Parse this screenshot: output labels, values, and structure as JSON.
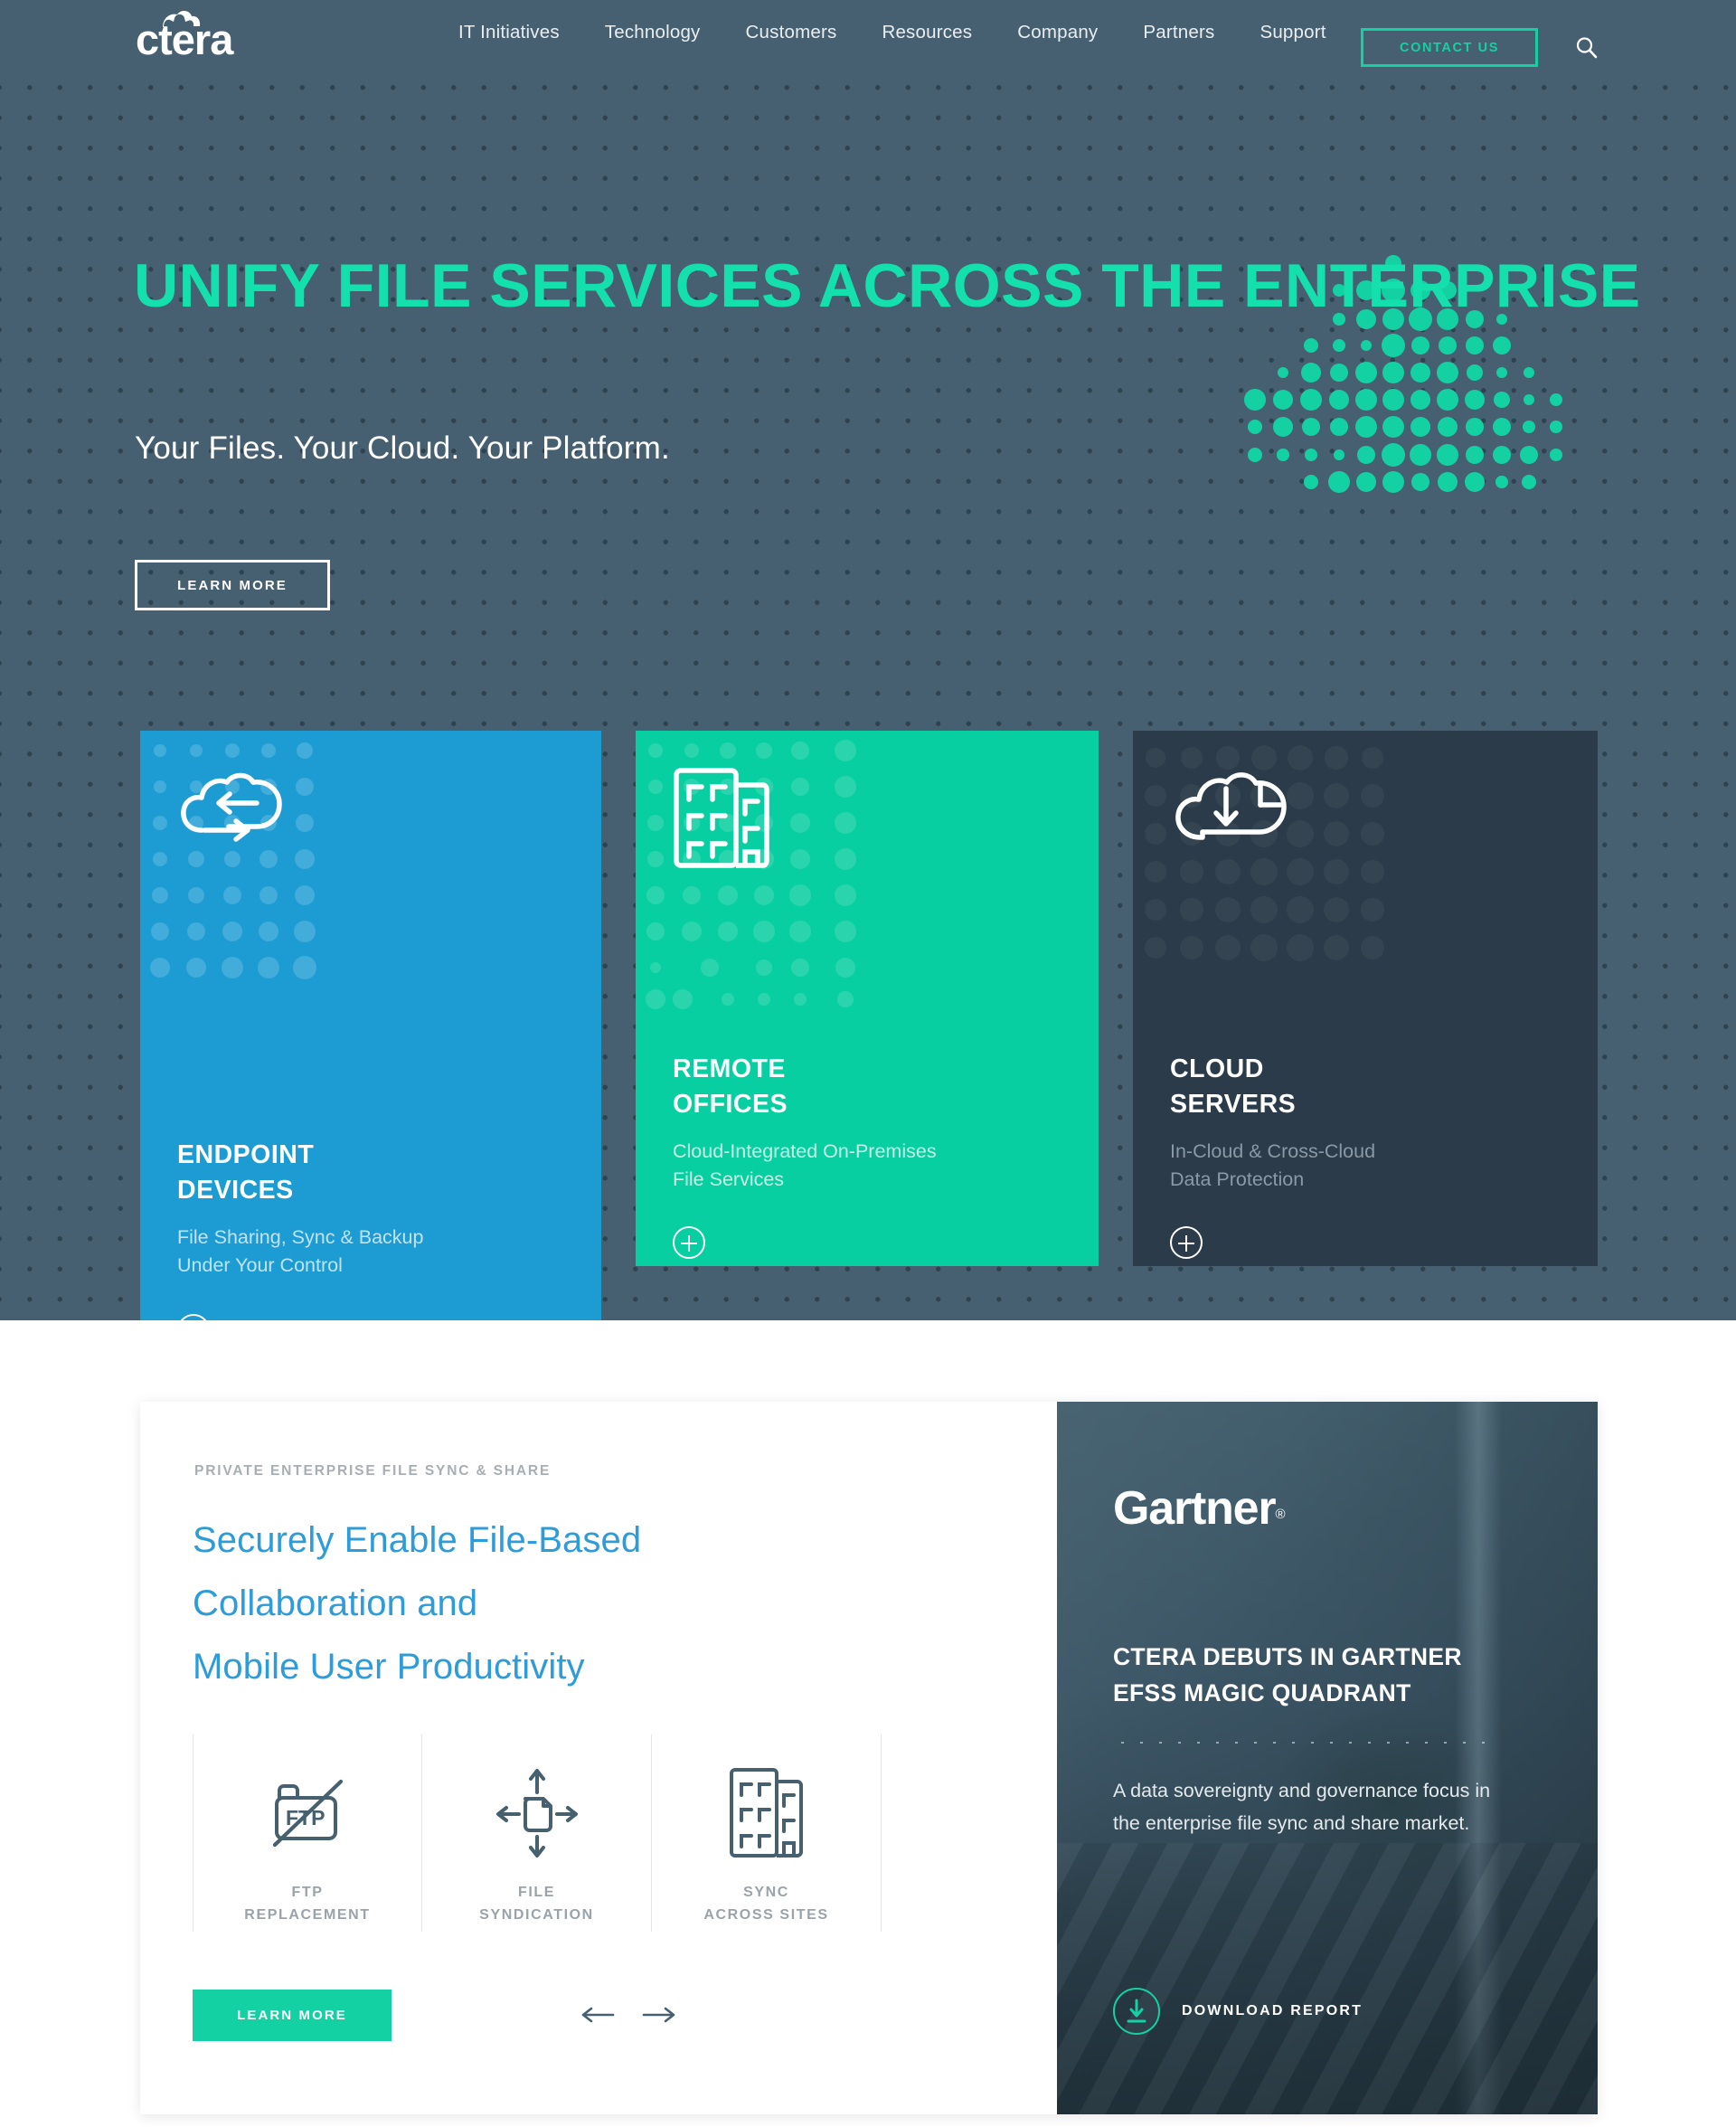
{
  "brand": {
    "logo_text": "ctera",
    "accent_teal": "#14d1a4",
    "accent_blue": "#1d9cd3",
    "hero_bg": "#466071",
    "heading_teal": "#14e0ae"
  },
  "nav": {
    "links": [
      {
        "label": "IT Initiatives"
      },
      {
        "label": "Technology"
      },
      {
        "label": "Customers"
      },
      {
        "label": "Resources"
      },
      {
        "label": "Company"
      },
      {
        "label": "Partners"
      },
      {
        "label": "Support"
      }
    ],
    "contact_label": "CONTACT US",
    "search_icon": "search-icon"
  },
  "hero": {
    "title": "UNIFY FILE SERVICES\nACROSS THE ENTERPRISE",
    "subtitle": "Your Files. Your Cloud. Your Platform.",
    "cta_label": "LEARN MORE"
  },
  "cards": [
    {
      "id": "endpoint-devices",
      "icon": "cloud-sync-icon",
      "title": "ENDPOINT\nDEVICES",
      "desc": "File Sharing, Sync & Backup\nUnder Your Control",
      "toggle": "close",
      "bg": "#1d9cd3",
      "active": true
    },
    {
      "id": "remote-offices",
      "icon": "office-buildings-icon",
      "title": "REMOTE\nOFFICES",
      "desc": "Cloud-Integrated On-Premises\nFile Services",
      "toggle": "plus",
      "bg": "#07cfa1",
      "active": false
    },
    {
      "id": "cloud-servers",
      "icon": "cloud-backup-clock-icon",
      "title": "CLOUD\nSERVERS",
      "desc": "In-Cloud & Cross-Cloud\nData Protection",
      "toggle": "plus",
      "bg": "#2b3b49",
      "active": false
    }
  ],
  "panel": {
    "eyebrow": "PRIVATE ENTERPRISE FILE SYNC & SHARE",
    "heading": "Securely Enable File-Based\nCollaboration and\nMobile User Productivity",
    "features": [
      {
        "icon": "ftp-crossed-out-icon",
        "label": "FTP\nREPLACEMENT"
      },
      {
        "icon": "file-syndication-arrows-icon",
        "label": "FILE\nSYNDICATION"
      },
      {
        "icon": "office-buildings-icon",
        "label": "SYNC\nACROSS SITES"
      }
    ],
    "cta_label": "LEARN MORE",
    "prev_icon": "arrow-left-icon",
    "next_icon": "arrow-right-icon"
  },
  "promo": {
    "logo": "Gartner",
    "logo_mark": "®",
    "title": "CTERA DEBUTS IN GARTNER\nEFSS MAGIC QUADRANT",
    "body": "A data sovereignty and governance focus in the enterprise file sync and share market.",
    "download_label": "DOWNLOAD REPORT",
    "download_icon": "download-circle-icon"
  }
}
